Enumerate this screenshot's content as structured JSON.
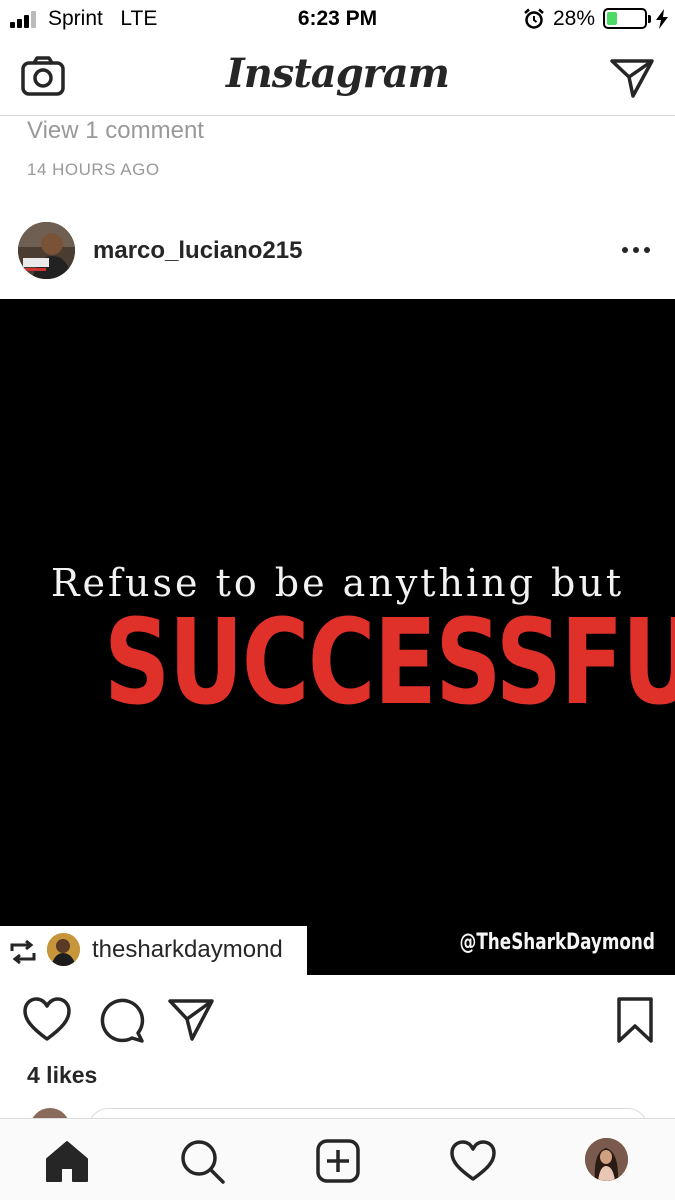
{
  "status_bar": {
    "carrier": "Sprint",
    "network": "LTE",
    "time": "6:23 PM",
    "battery_percent": "28%",
    "battery_level": 0.28,
    "icons": [
      "signal-icon",
      "alarm-icon",
      "battery-icon",
      "charging-icon"
    ]
  },
  "header": {
    "title": "Instagram",
    "left_icon": "camera-icon",
    "right_icon": "direct-message-icon"
  },
  "previous_post": {
    "view_comments": "View 1 comment",
    "time_ago": "14 HOURS AGO"
  },
  "post": {
    "username": "marco_luciano215",
    "more_icon": "more-options-icon",
    "image": {
      "line1": "Refuse to be anything but",
      "line2": "SUCCESSFUL.",
      "watermark": "@TheSharkDaymond",
      "text_color": "#e0302a"
    },
    "repost": {
      "username": "thesharkdaymond",
      "icon": "repost-icon"
    },
    "actions": [
      "like-icon",
      "comment-icon",
      "share-icon",
      "bookmark-icon"
    ],
    "likes": "4 likes"
  },
  "tab_bar": {
    "items": [
      "home-icon",
      "search-icon",
      "new-post-icon",
      "activity-icon",
      "profile-avatar"
    ],
    "active": "home-icon"
  }
}
